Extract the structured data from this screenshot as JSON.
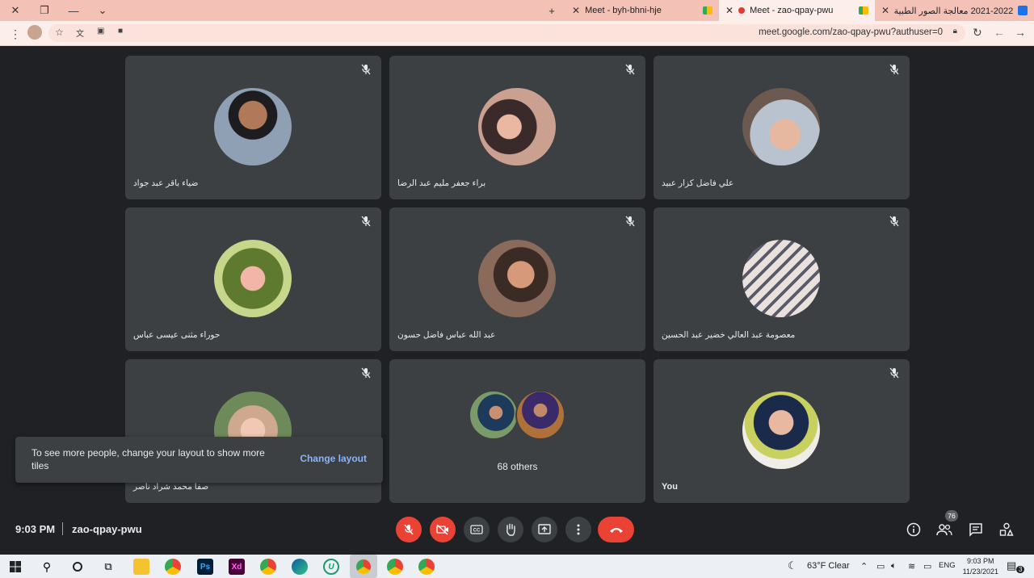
{
  "browser": {
    "tabs": [
      {
        "title": "Meet - byh-bhni-hje"
      },
      {
        "title": "Meet - zao-qpay-pwu"
      },
      {
        "title": "2021-2022 معالجة الصور الطبية"
      }
    ],
    "url": "meet.google.com/zao-qpay-pwu?authuser=0"
  },
  "tiles": [
    {
      "name": "ضياء باقر عبد جواد",
      "muted": true
    },
    {
      "name": "براء جعفر مليم عبد الرضا",
      "muted": true
    },
    {
      "name": "علي فاضل كزار عبيد",
      "muted": true
    },
    {
      "name": "حوراء مثنى عيسى عباس",
      "muted": true
    },
    {
      "name": "عبد الله عباس فاضل حسون",
      "muted": true
    },
    {
      "name": "معصومة عبد العالي خضير عبد الحسين",
      "muted": true
    },
    {
      "name": "صفا محمد شراد ناصر",
      "muted": true
    },
    {
      "name": "68 others",
      "muted": false
    },
    {
      "name": "You",
      "muted": true
    }
  ],
  "toast": {
    "message": "To see more people, change your layout to show more tiles",
    "action": "Change layout"
  },
  "meeting": {
    "time": "9:03 PM",
    "code": "zao-qpay-pwu",
    "participant_count": "76"
  },
  "taskbar": {
    "weather": "63°F  Clear",
    "lang": "ENG",
    "time": "9:03 PM",
    "date": "11/23/2021",
    "notif_count": "3"
  },
  "colors": {
    "stage_bg": "#202124",
    "tile_bg": "#3c4043",
    "danger": "#ea4335",
    "link": "#8ab4f8"
  }
}
